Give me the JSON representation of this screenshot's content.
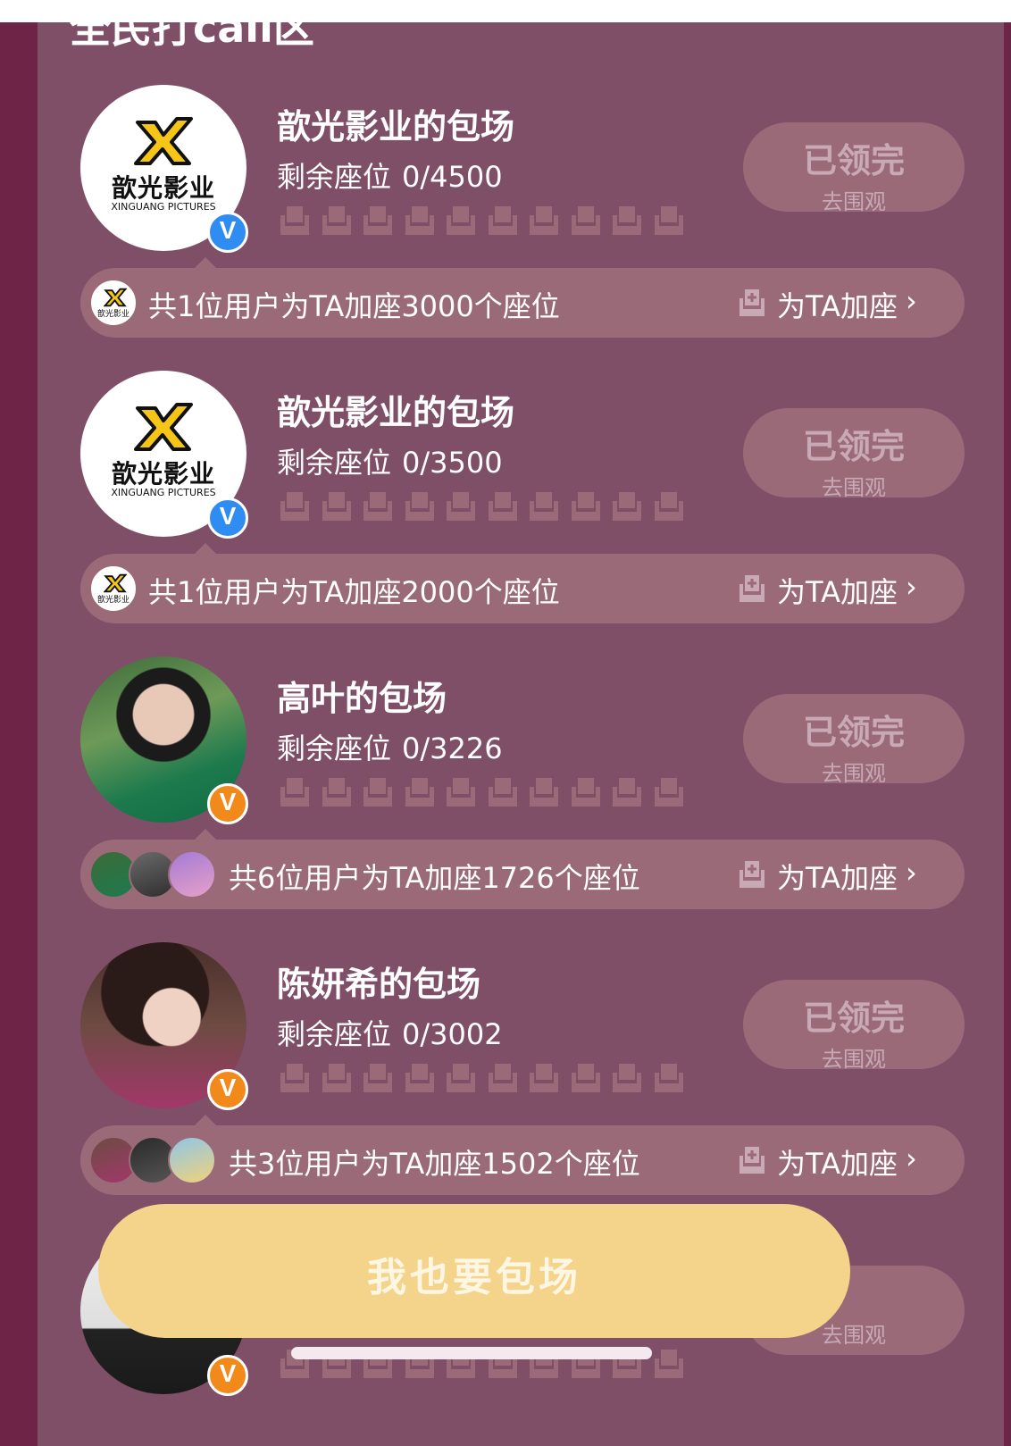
{
  "panel": {
    "heading": "全民打call区"
  },
  "badges": {
    "verified": "V"
  },
  "logo": {
    "cn": "歆光影业",
    "en": "XINGUANG PICTURES",
    "mini_cn": "歆光影业"
  },
  "cards": [
    {
      "title": "歆光影业的包场",
      "seat_label": "剩余座位",
      "seat_count": "0/4500",
      "claim_label": "已领完",
      "watch_label": "去围观",
      "support_text": "共1位用户为TA加座3000个座位",
      "add_label": "为TA加座",
      "chevron": "›"
    },
    {
      "title": "歆光影业的包场",
      "seat_label": "剩余座位",
      "seat_count": "0/3500",
      "claim_label": "已领完",
      "watch_label": "去围观",
      "support_text": "共1位用户为TA加座2000个座位",
      "add_label": "为TA加座",
      "chevron": "›"
    },
    {
      "title": "高叶的包场",
      "seat_label": "剩余座位",
      "seat_count": "0/3226",
      "claim_label": "已领完",
      "watch_label": "去围观",
      "support_text": "共6位用户为TA加座1726个座位",
      "add_label": "为TA加座",
      "chevron": "›"
    },
    {
      "title": "陈妍希的包场",
      "seat_label": "剩余座位",
      "seat_count": "0/3002",
      "claim_label": "已领完",
      "watch_label": "去围观",
      "support_text": "共3位用户为TA加座1502个座位",
      "add_label": "为TA加座",
      "chevron": "›"
    },
    {
      "watch_label": "去围观"
    }
  ],
  "cta": {
    "label": "我也要包场"
  },
  "colors": {
    "page_bg": "#6e2447",
    "panel_bg": "#7f4f68",
    "pill_bg": "#9a6a78",
    "cta_bg": "#f4d48a",
    "badge_blue": "#2f8cf0",
    "badge_orange": "#f28a1b"
  }
}
